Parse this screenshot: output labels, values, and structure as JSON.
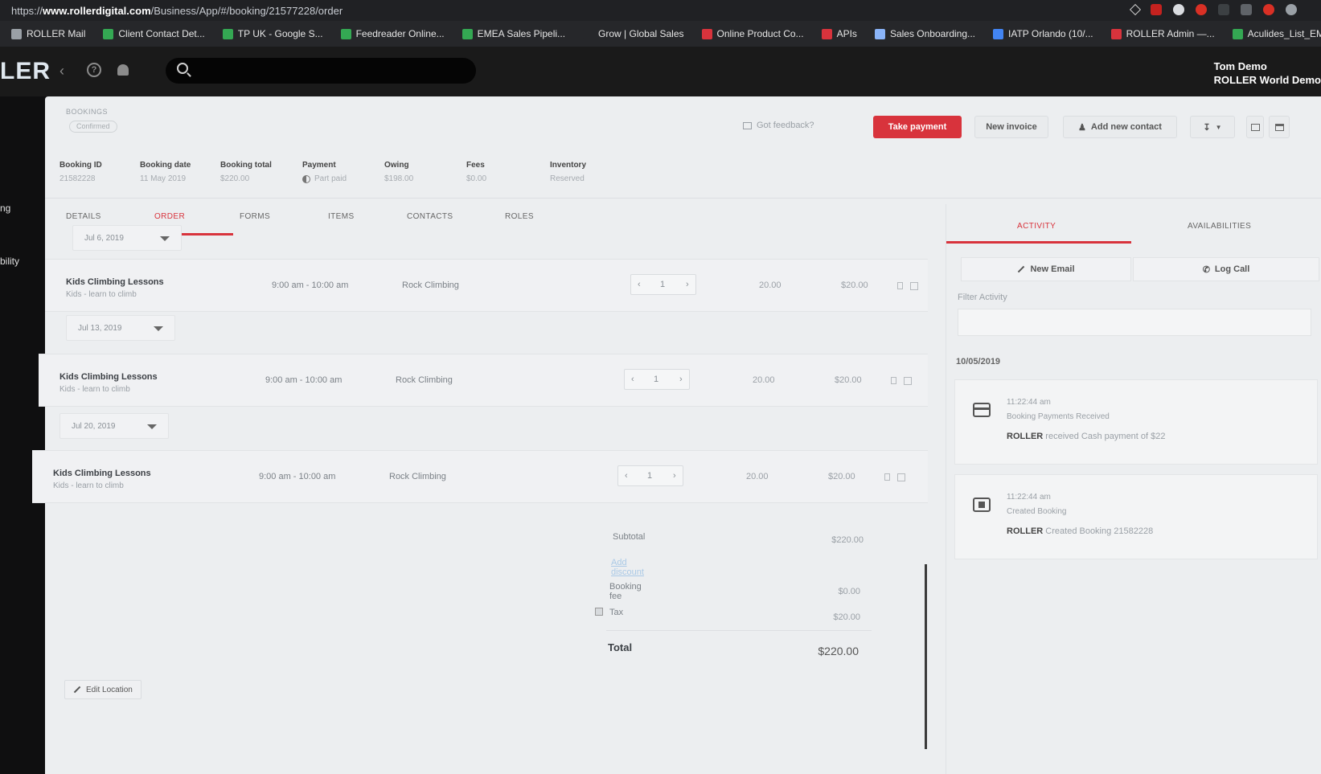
{
  "browser": {
    "url_prefix": "https://",
    "url_domain": "www.rollerdigital.com",
    "url_path": "/Business/App/#/booking/21577228/order",
    "bookmarks": [
      {
        "label": "ROLLER Mail",
        "color": "#9aa0a6"
      },
      {
        "label": "Client Contact Det...",
        "color": "#34a853"
      },
      {
        "label": "TP UK - Google S...",
        "color": "#34a853"
      },
      {
        "label": "Feedreader Online...",
        "color": "#34a853"
      },
      {
        "label": "EMEA Sales Pipeli...",
        "color": "#34a853"
      },
      {
        "label": "Grow | Global Sales",
        "color": "#26272a"
      },
      {
        "label": "Online Product Co...",
        "color": "#d8333c"
      },
      {
        "label": "APIs",
        "color": "#d8333c"
      },
      {
        "label": "Sales Onboarding...",
        "color": "#8ab4f8"
      },
      {
        "label": "IATP Orlando (10/...",
        "color": "#4285f4"
      },
      {
        "label": "ROLLER Admin —...",
        "color": "#d8333c"
      },
      {
        "label": "Aculides_List_EME...",
        "color": "#34a853"
      }
    ]
  },
  "app": {
    "logo": "LER",
    "user_name": "Tom Demo",
    "user_org": "ROLLER World Demo"
  },
  "leftnav": {
    "items": [
      "ng",
      "bility"
    ]
  },
  "booking": {
    "crumb": "BOOKINGS",
    "status": "Confirmed",
    "feedback": "Got feedback?",
    "take_payment": "Take payment",
    "new_invoice": "New invoice",
    "add_contact": "Add new contact",
    "summary": [
      {
        "label": "Booking ID",
        "value": "21582228"
      },
      {
        "label": "Booking date",
        "value": "11 May 2019"
      },
      {
        "label": "Booking total",
        "value": "$220.00"
      },
      {
        "label": "Payment",
        "value": "Part paid"
      },
      {
        "label": "Owing",
        "value": "$198.00"
      },
      {
        "label": "Fees",
        "value": "$0.00"
      },
      {
        "label": "Inventory",
        "value": "Reserved"
      }
    ]
  },
  "tabs": [
    "DETAILS",
    "ORDER",
    "FORMS",
    "ITEMS",
    "CONTACTS",
    "ROLES"
  ],
  "order": {
    "groups": [
      {
        "date": "Jul 6, 2019",
        "name": "Kids Climbing Lessons",
        "sub": "Kids - learn to climb",
        "time": "9:00 am - 10:00 am",
        "location": "Rock Climbing",
        "qty": "1",
        "price": "20.00",
        "amount": "$20.00"
      },
      {
        "date": "Jul 13, 2019",
        "name": "Kids Climbing Lessons",
        "sub": "Kids - learn to climb",
        "time": "9:00 am - 10:00 am",
        "location": "Rock Climbing",
        "qty": "1",
        "price": "20.00",
        "amount": "$20.00"
      },
      {
        "date": "Jul 20, 2019",
        "name": "Kids Climbing Lessons",
        "sub": "Kids - learn to climb",
        "time": "9:00 am - 10:00 am",
        "location": "Rock Climbing",
        "qty": "1",
        "price": "20.00",
        "amount": "$20.00"
      }
    ],
    "totals": {
      "subtotal_label": "Subtotal",
      "subtotal": "$220.00",
      "discount_link": "Add discount",
      "fee_label": "Booking fee",
      "fee": "$0.00",
      "tax_label": "Tax",
      "tax": "$20.00",
      "total_label": "Total",
      "total": "$220.00"
    },
    "edit_location": "Edit Location"
  },
  "activity": {
    "tab_activity": "ACTIVITY",
    "tab_availabilities": "AVAILABILITIES",
    "new_email": "New Email",
    "log_call": "Log Call",
    "filter_label": "Filter Activity",
    "date": "10/05/2019",
    "items": [
      {
        "time": "11:22:44 am",
        "title": "Booking Payments Received",
        "actor": "ROLLER",
        "desc": "received Cash payment of $22"
      },
      {
        "time": "11:22:44 am",
        "title": "Created Booking",
        "actor": "ROLLER",
        "desc": "Created Booking 21582228"
      }
    ]
  }
}
